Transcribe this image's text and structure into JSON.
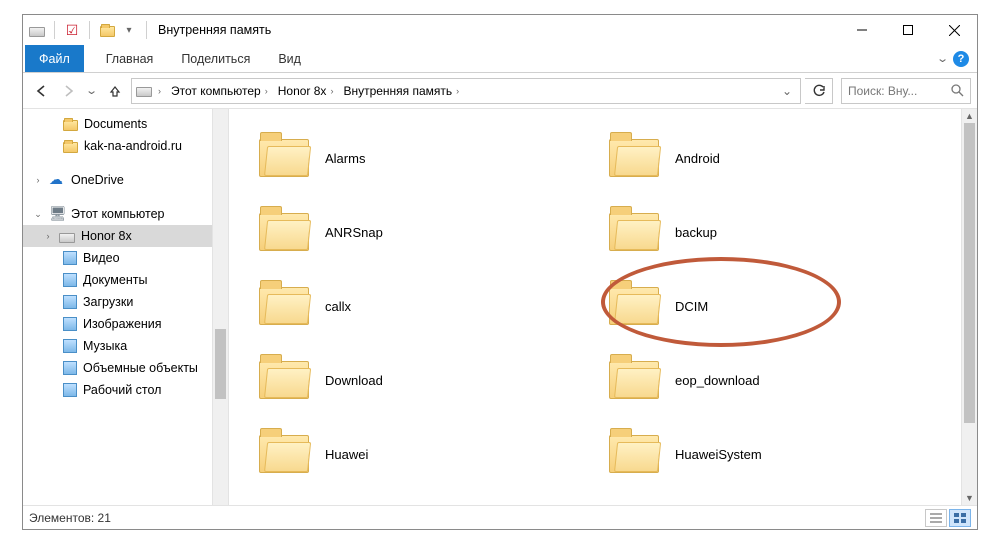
{
  "window": {
    "title": "Внутренняя память"
  },
  "ribbon": {
    "file": "Файл",
    "tabs": [
      "Главная",
      "Поделиться",
      "Вид"
    ]
  },
  "breadcrumb": [
    "Этот компьютер",
    "Honor 8x",
    "Внутренняя память"
  ],
  "search_placeholder": "Поиск: Вну...",
  "nav": {
    "quick": [
      {
        "label": "Documents",
        "kind": "folder"
      },
      {
        "label": "kak-na-android.ru",
        "kind": "folder"
      }
    ],
    "onedrive": "OneDrive",
    "thispc": "Этот компьютер",
    "drive": "Honor 8x",
    "pcchildren": [
      {
        "label": "Видео",
        "kind": "generic"
      },
      {
        "label": "Документы",
        "kind": "generic"
      },
      {
        "label": "Загрузки",
        "kind": "generic"
      },
      {
        "label": "Изображения",
        "kind": "generic"
      },
      {
        "label": "Музыка",
        "kind": "generic"
      },
      {
        "label": "Объемные объекты",
        "kind": "generic"
      },
      {
        "label": "Рабочий стол",
        "kind": "generic"
      }
    ]
  },
  "folders": [
    "Alarms",
    "Android",
    "ANRSnap",
    "backup",
    "callx",
    "DCIM",
    "Download",
    "eop_download",
    "Huawei",
    "HuaweiSystem"
  ],
  "status": {
    "text": "Элементов: 21"
  }
}
